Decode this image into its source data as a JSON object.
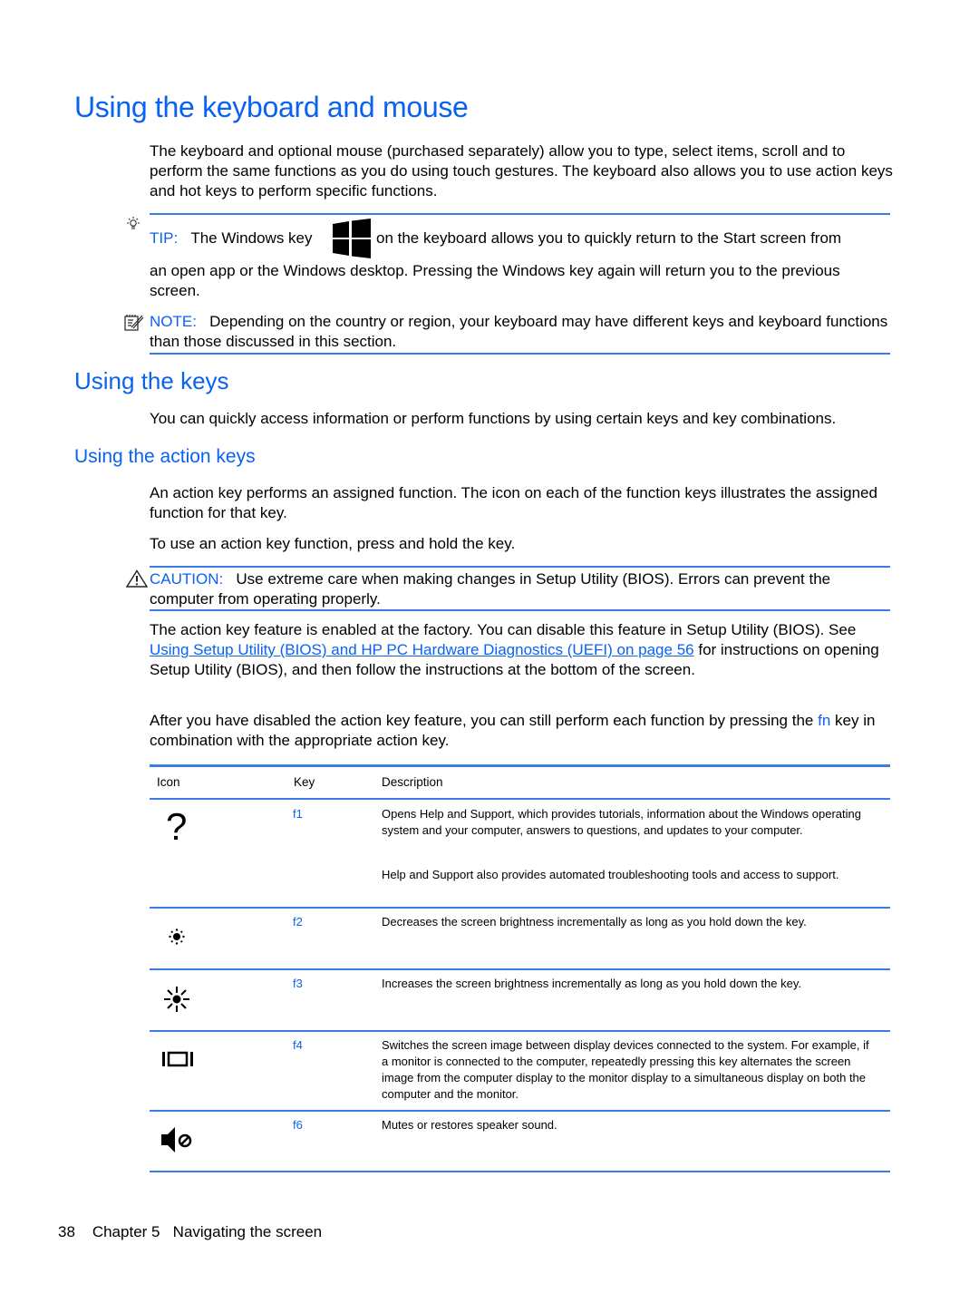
{
  "page": {
    "title": "Using the keyboard and mouse",
    "intro": "The keyboard and optional mouse (purchased separately) allow you to type, select items, scroll and to perform the same functions as you do using touch gestures. The keyboard also allows you to use action keys and hot keys to perform specific functions.",
    "tip": {
      "icon": "lightbulb-icon",
      "label": "TIP:",
      "text_before": "The Windows key",
      "inline_icon": "windows-logo-icon",
      "text_after": "on the keyboard allows you to quickly return to the Start screen from",
      "continued": "an open app or the Windows desktop. Pressing the Windows key again will return you to the previous screen."
    },
    "note": {
      "icon": "note-pencil-icon",
      "label": "NOTE:",
      "text": "Depending on the country or region, your keyboard may have different keys and keyboard functions than those discussed in this section."
    },
    "section": {
      "title": "Using the keys",
      "text": "You can quickly access information or perform functions by using certain keys and key combinations."
    },
    "subsection": {
      "title": "Using the action keys",
      "para1": "An action key performs an assigned function. The icon on each of the function keys illustrates the assigned function for that key.",
      "para2": "To use an action key function, press and hold the key.",
      "caution": {
        "icon": "warning-triangle-icon",
        "label": "CAUTION:",
        "text": "Use extreme care when making changes in Setup Utility (BIOS). Errors can prevent the computer from operating properly."
      },
      "para3_before": "The action key feature is enabled at the factory. You can disable this feature in Setup Utility (BIOS). See",
      "para3_link": "Using Setup Utility (BIOS) and HP PC Hardware Diagnostics (UEFI) on page 56",
      "para3_after": "for instructions on opening Setup Utility (BIOS), and then follow the instructions at the bottom of the screen.",
      "para4_before": "After you have disabled the action key feature, you can still perform each function by pressing the",
      "para4_key": "fn",
      "para4_after": "key in combination with the appropriate action key."
    },
    "table": {
      "headers": [
        "Icon",
        "Key",
        "Description"
      ],
      "rows": [
        {
          "icon": "question-mark-icon",
          "key": "f1",
          "description": [
            "Opens Help and Support, which provides tutorials, information about the Windows operating system and your computer, answers to questions, and updates to your computer.",
            "Help and Support also provides automated troubleshooting tools and access to support."
          ]
        },
        {
          "icon": "brightness-down-icon",
          "key": "f2",
          "description": [
            "Decreases the screen brightness incrementally as long as you hold down the key."
          ]
        },
        {
          "icon": "brightness-up-icon",
          "key": "f3",
          "description": [
            "Increases the screen brightness incrementally as long as you hold down the key."
          ]
        },
        {
          "icon": "switch-display-icon",
          "key": "f4",
          "description": [
            "Switches the screen image between display devices connected to the system. For example, if a monitor is connected to the computer, repeatedly pressing this key alternates the screen image from the computer display to the monitor display to a simultaneous display on both the computer and the monitor."
          ]
        },
        {
          "icon": "mute-icon",
          "key": "f6",
          "description": [
            "Mutes or restores speaker sound."
          ]
        }
      ]
    },
    "footer": {
      "page_number": "38",
      "chapter": "Chapter 5",
      "chapter_title": "Navigating the screen"
    }
  }
}
